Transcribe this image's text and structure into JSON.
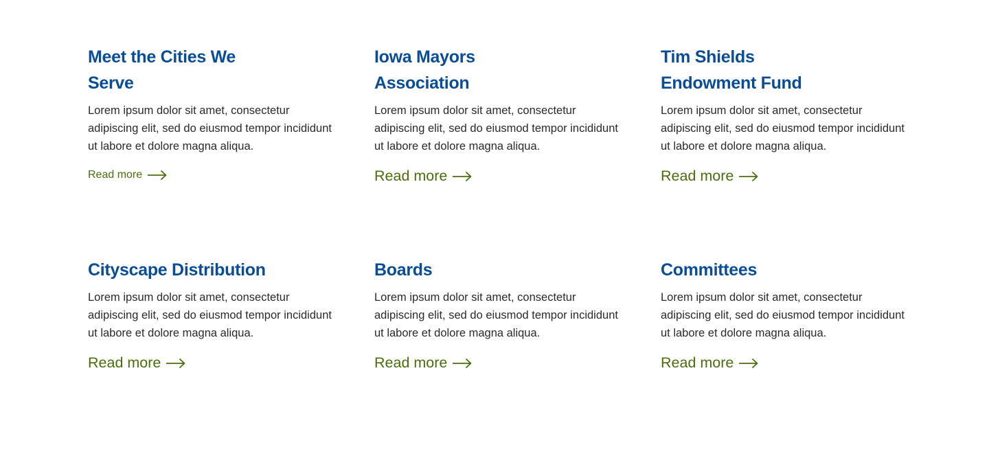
{
  "colors": {
    "title": "#0a4d97",
    "body": "#2a2a2a",
    "link": "#4a6e0c",
    "background": "#ffffff"
  },
  "cards": [
    {
      "title": "Meet the Cities We Serve",
      "body": "Lorem ipsum dolor sit amet, consectetur adipiscing elit, sed do eiusmod tempor incididunt ut labore et dolore magna aliqua.",
      "link_label": "Read more",
      "link_icon": "arrow-right-icon"
    },
    {
      "title": "Iowa Mayors Association",
      "body": "Lorem ipsum dolor sit amet, consectetur adipiscing elit, sed do eiusmod tempor incididunt ut labore et dolore magna aliqua.",
      "link_label": "Read more",
      "link_icon": "arrow-right-icon"
    },
    {
      "title": "Tim Shields Endowment Fund",
      "body": "Lorem ipsum dolor sit amet, consectetur adipiscing elit, sed do eiusmod tempor incididunt ut labore et dolore magna aliqua.",
      "link_label": "Read more",
      "link_icon": "arrow-right-icon"
    },
    {
      "title": "Cityscape Distribution",
      "body": "Lorem ipsum dolor sit amet, consectetur adipiscing elit, sed do eiusmod tempor incididunt ut labore et dolore magna aliqua.",
      "link_label": "Read more",
      "link_icon": "arrow-right-icon"
    },
    {
      "title": "Boards",
      "body": "Lorem ipsum dolor sit amet, consectetur adipiscing elit, sed do eiusmod tempor incididunt ut labore et dolore magna aliqua.",
      "link_label": "Read more",
      "link_icon": "arrow-right-icon"
    },
    {
      "title": "Committees",
      "body": "Lorem ipsum dolor sit amet, consectetur adipiscing elit, sed do eiusmod tempor incididunt ut labore et dolore magna aliqua.",
      "link_label": "Read more",
      "link_icon": "arrow-right-icon"
    }
  ]
}
